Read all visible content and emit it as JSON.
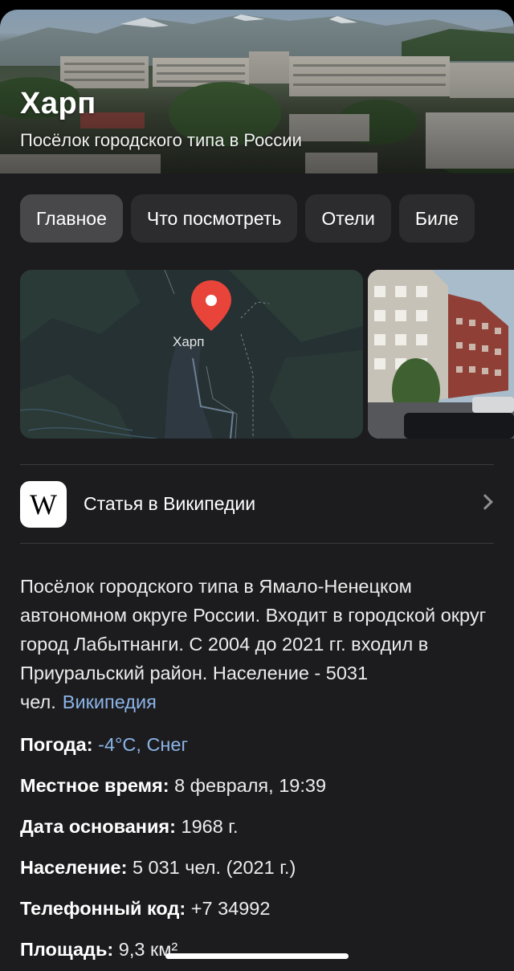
{
  "hero": {
    "title": "Харп",
    "subtitle": "Посёлок городского типа в России"
  },
  "tabs": [
    {
      "label": "Главное",
      "active": true
    },
    {
      "label": "Что посмотреть",
      "active": false
    },
    {
      "label": "Отели",
      "active": false
    },
    {
      "label": "Биле",
      "active": false
    }
  ],
  "map": {
    "place_label": "Харп",
    "pin_color": "#e8443a"
  },
  "wiki": {
    "logo_letter": "W",
    "label": "Статья в Википедии"
  },
  "description": {
    "text": "Посёлок городского типа в Ямало-Ненецком автономном округе России. Входит в городской округ город Лабытнанги. С 2004 до 2021 гг. входил в Приуральский район. Население - 5031 чел.",
    "source_link": "Википедия"
  },
  "facts": {
    "weather": {
      "label": "Погода:",
      "value": "-4°C, Снег"
    },
    "local_time": {
      "label": "Местное время:",
      "value": "8 февраля, 19:39"
    },
    "founded": {
      "label": "Дата основания:",
      "value": "1968 г."
    },
    "population": {
      "label": "Население:",
      "value": "5 031 чел. (2021 г.)"
    },
    "phone_code": {
      "label": "Телефонный код:",
      "value": "+7 34992"
    },
    "area": {
      "label": "Площадь:",
      "value": "9,3 км²"
    }
  },
  "colors": {
    "background": "#1c1c1e",
    "tab": "#2c2c2e",
    "tab_active": "#48484a",
    "link": "#8bb4e8"
  }
}
